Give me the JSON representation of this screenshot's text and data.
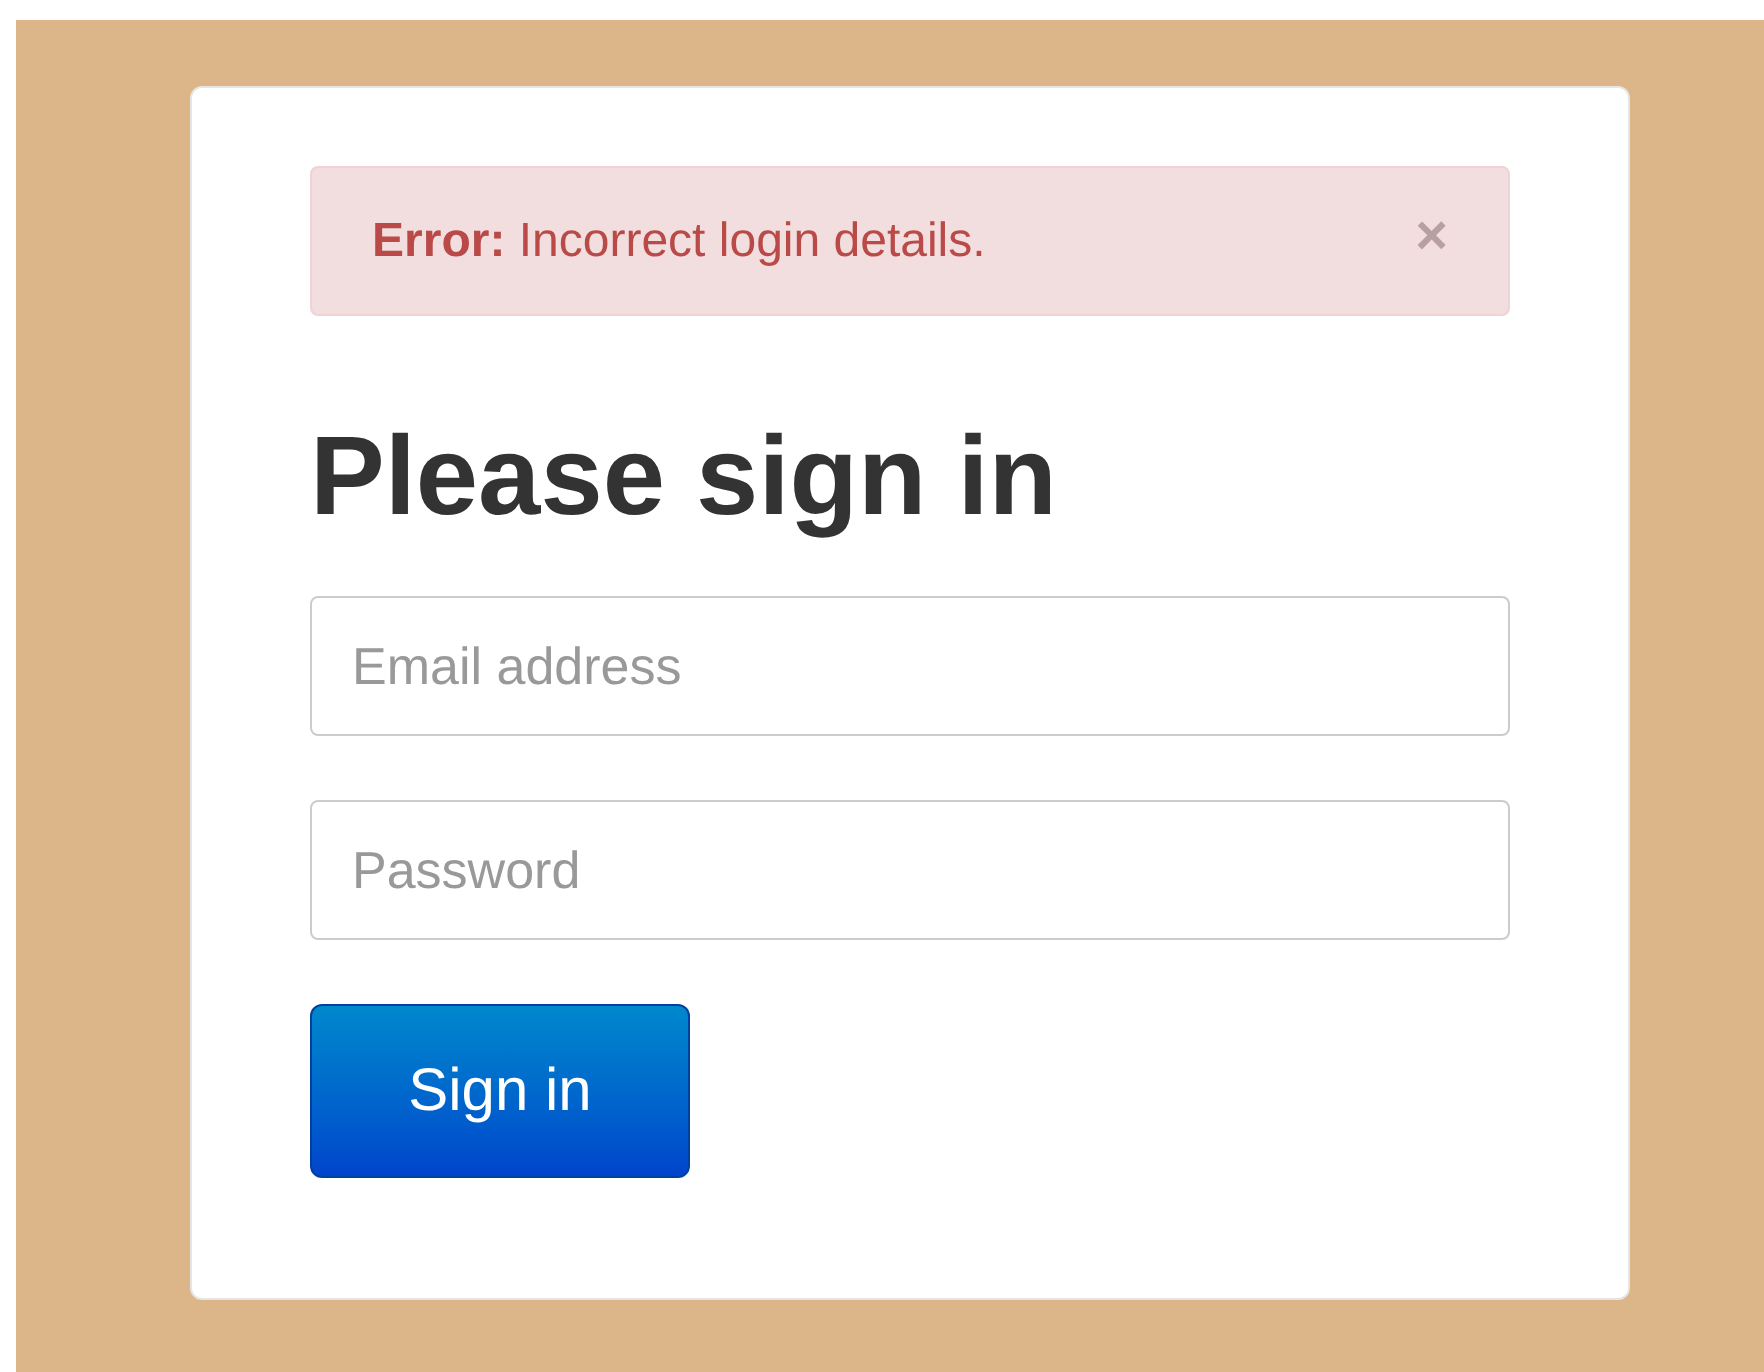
{
  "alert": {
    "message": "**Error:** Incorrect login details.",
    "close": "×"
  },
  "heading": "Please sign in",
  "fields": [
    {
      "placeholder": "Email address"
    },
    {
      "placeholder": "Password"
    }
  ],
  "button": "Sign in"
}
